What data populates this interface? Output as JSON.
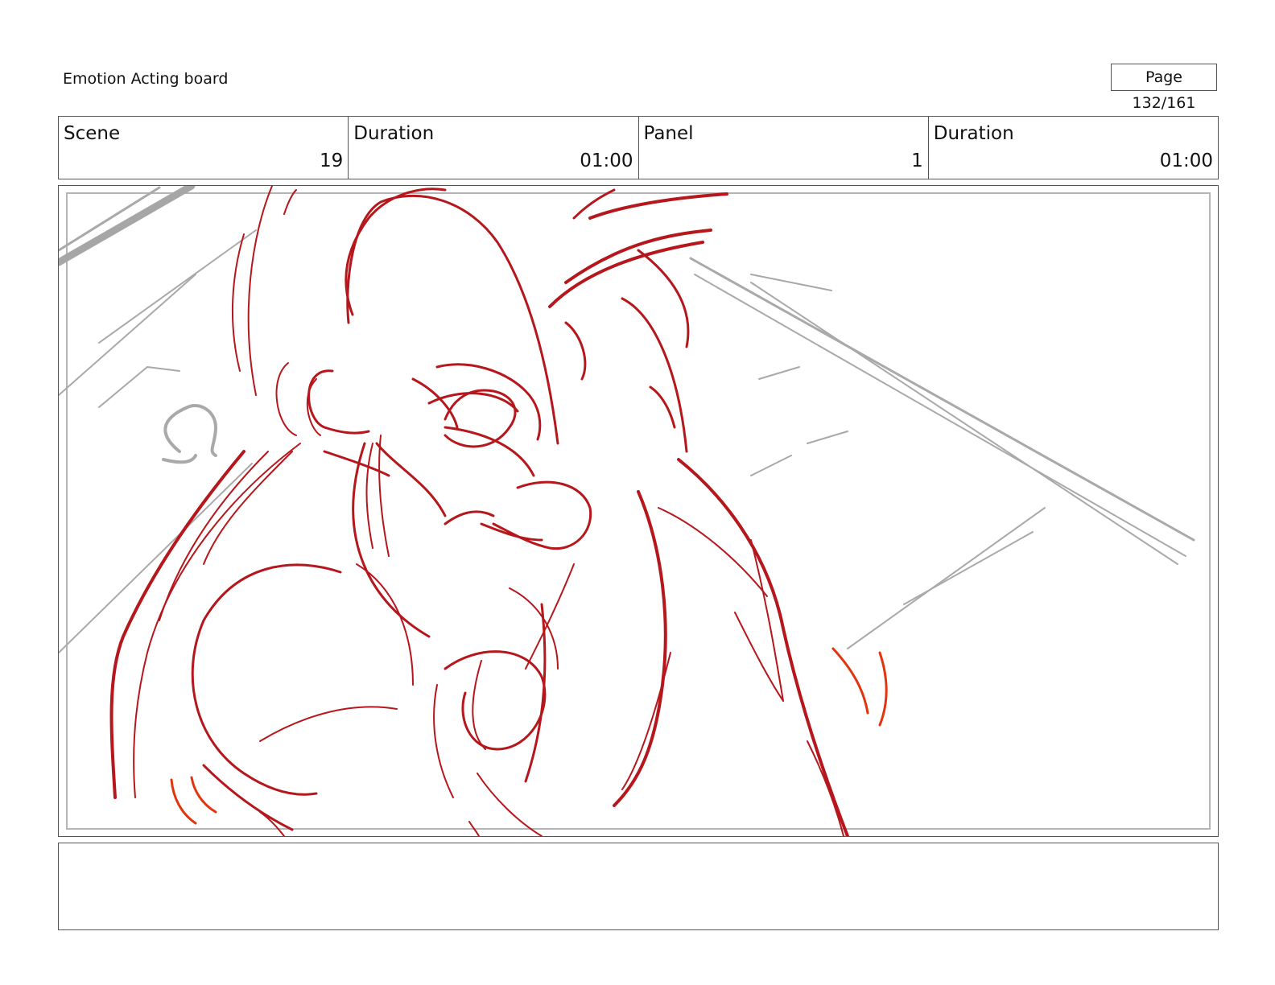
{
  "header": {
    "title": "Emotion Acting board",
    "page": "Page 132/161"
  },
  "info": {
    "scene_label": "Scene",
    "scene_value": "19",
    "scene_duration_label": "Duration",
    "scene_duration_value": "01:00",
    "panel_label": "Panel",
    "panel_value": "1",
    "panel_duration_label": "Duration",
    "panel_duration_value": "01:00"
  },
  "colors": {
    "sketch_red": "#b5171c",
    "motion_orange": "#e2350f",
    "background_gray": "#a9a9a9"
  },
  "notes": ""
}
